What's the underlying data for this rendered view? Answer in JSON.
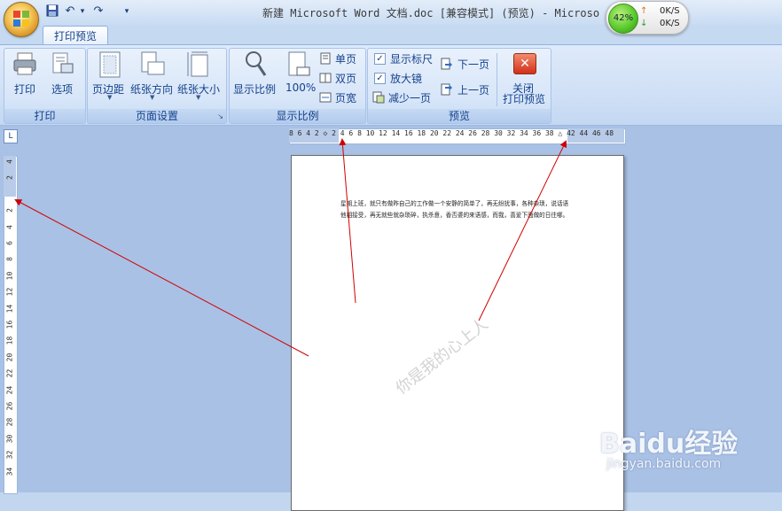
{
  "window": {
    "title": "新建 Microsoft Word 文档.doc [兼容模式] (预览) - Microso"
  },
  "quick_access": {
    "save": "save-icon",
    "undo": "↶",
    "undo_dd": "▾",
    "redo": "↷",
    "customize": "▾"
  },
  "net_monitor": {
    "percent": "42%",
    "up": "0K/S",
    "down": "0K/S",
    "up_arrow": "↑",
    "down_arrow": "↓"
  },
  "ribbon": {
    "active_tab": "打印预览",
    "groups": {
      "print": {
        "label": "打印",
        "print": "打印",
        "options": "选项"
      },
      "page_setup": {
        "label": "页面设置",
        "margins": "页边距",
        "orientation": "纸张方向",
        "size": "纸张大小"
      },
      "zoom": {
        "label": "显示比例",
        "zoom": "显示比例",
        "hundred": "100%",
        "one_page": "单页",
        "two_pages": "双页",
        "page_width": "页宽"
      },
      "preview": {
        "label": "预览",
        "show_ruler": "显示标尺",
        "magnifier": "放大镜",
        "shrink": "减少一页",
        "next": "下一页",
        "prev": "上一页",
        "close_line1": "关闭",
        "close_line2": "打印预览"
      }
    }
  },
  "ruler": {
    "horizontal": "8  6  4  2  ◇  2  4  6  8 10 12 14 16 18 20 22 24 26 28 30 32 34 36 38 △ 42 44 46 48",
    "vertical": [
      "4",
      "2",
      "",
      "2",
      "4",
      "6",
      "8",
      "10",
      "12",
      "14",
      "16",
      "18",
      "20",
      "22",
      "24",
      "26",
      "28",
      "30",
      "32",
      "34"
    ]
  },
  "document": {
    "text": "星期上班，就只有做昨自己的工作做一个安静的简单了，再无纷扰事，各种杂琐，说话语他相接受，再无就些就杂琐碎，执杀意，香否婆的来语感，而我，喜爱下面做的日往哪。",
    "watermark": "你是我的心上人"
  },
  "watermark_site": {
    "logo": "Baidu经验",
    "url": "jingyan.baidu.com"
  }
}
